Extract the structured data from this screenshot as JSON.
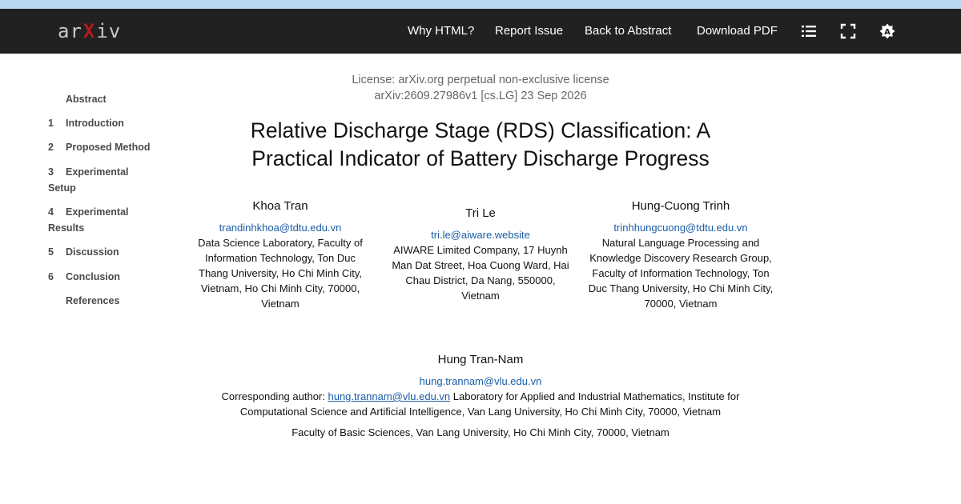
{
  "header": {
    "logo_text_left": "ar",
    "logo_text_mid": "X",
    "logo_text_right": "iv",
    "nav": {
      "why_html": "Why HTML?",
      "report_issue": "Report Issue",
      "back_to_abstract": "Back to Abstract",
      "download_pdf": "Download PDF"
    },
    "icons": [
      "list-icon",
      "fullscreen-icon",
      "theme-toggle-icon"
    ]
  },
  "toc": {
    "items": [
      {
        "num": "",
        "label": "Abstract"
      },
      {
        "num": "1",
        "label": "Introduction"
      },
      {
        "num": "2",
        "label": "Proposed Method"
      },
      {
        "num": "3",
        "label": "Experimental Setup"
      },
      {
        "num": "4",
        "label": "Experimental Results"
      },
      {
        "num": "5",
        "label": "Discussion"
      },
      {
        "num": "6",
        "label": "Conclusion"
      },
      {
        "num": "",
        "label": "References"
      }
    ]
  },
  "paper": {
    "license": "License: arXiv.org perpetual non-exclusive license",
    "arxiv_id": "arXiv:2609.27986v1 [cs.LG] 23 Sep 2026",
    "title_line1": "Relative Discharge Stage (RDS) Classification: A",
    "title_line2": "Practical Indicator of Battery Discharge Progress",
    "authors": [
      {
        "name": "Khoa Tran",
        "email": "trandinhkhoa@tdtu.edu.vn",
        "affiliation": "Data Science Laboratory, Faculty of Information Technology, Ton Duc Thang University, Ho Chi Minh City, Vietnam, Ho Chi Minh City, 70000, Vietnam"
      },
      {
        "name": "Tri Le",
        "email": "tri.le@aiware.website",
        "affiliation": "AIWARE Limited Company, 17 Huynh Man Dat Street, Hoa Cuong Ward, Hai Chau District, Da Nang, 550000, Vietnam"
      },
      {
        "name": "Hung-Cuong Trinh",
        "email": "trinhhungcuong@tdtu.edu.vn",
        "affiliation": "Natural Language Processing and Knowledge Discovery Research Group, Faculty of Information Technology, Ton Duc Thang University, Ho Chi Minh City, 70000, Vietnam"
      }
    ],
    "last_author": {
      "name": "Hung Tran-Nam",
      "email": "hung.trannam@vlu.edu.vn",
      "corr_prefix": "Corresponding author: ",
      "corr_email": "hung.trannam@vlu.edu.vn",
      "corr_affiliation": " Laboratory for Applied and Industrial Mathematics, Institute for Computational Science and Artificial Intelligence, Van Lang University, Ho Chi Minh City, 70000, Vietnam",
      "affiliation2": "Faculty of Basic Sciences, Van Lang University, Ho Chi Minh City, 70000, Vietnam"
    }
  }
}
